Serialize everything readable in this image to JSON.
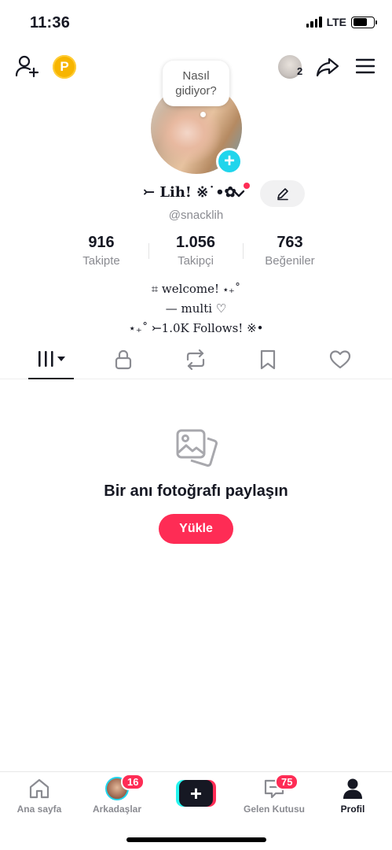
{
  "status_bar": {
    "time": "11:36",
    "network": "LTE"
  },
  "topnav": {
    "coin_letter": "P",
    "friends_count": "2"
  },
  "note": {
    "text_line1": "Nasıl",
    "text_line2": "gidiyor?"
  },
  "profile": {
    "display_name": "⤚ Lih! ※˙•✿",
    "username": "@snacklih",
    "stats": [
      {
        "value": "916",
        "label": "Takipte"
      },
      {
        "value": "1.056",
        "label": "Takipçi"
      },
      {
        "value": "763",
        "label": "Beğeniler"
      }
    ],
    "bio_lines": [
      "⌗ welcome! ⋆₊˚",
      "— multi ♡",
      "⋆₊˚ ⤚1.0K Follows! ※•"
    ]
  },
  "tabs": [
    {
      "name": "videos",
      "icon": "grid-icon"
    },
    {
      "name": "private",
      "icon": "lock-icon"
    },
    {
      "name": "reposts",
      "icon": "repost-icon"
    },
    {
      "name": "favorites",
      "icon": "bookmark-icon"
    },
    {
      "name": "liked",
      "icon": "heart-icon"
    }
  ],
  "empty_state": {
    "title": "Bir anı fotoğrafı paylaşın",
    "button_label": "Yükle"
  },
  "bottom_nav": {
    "home_label": "Ana sayfa",
    "friends_label": "Arkadaşlar",
    "friends_badge": "16",
    "inbox_label": "Gelen Kutusu",
    "inbox_badge": "75",
    "profile_label": "Profil"
  },
  "colors": {
    "accent": "#fe2c55",
    "cyan": "#20d5ec",
    "text": "#161823",
    "muted": "#8a8b91"
  }
}
